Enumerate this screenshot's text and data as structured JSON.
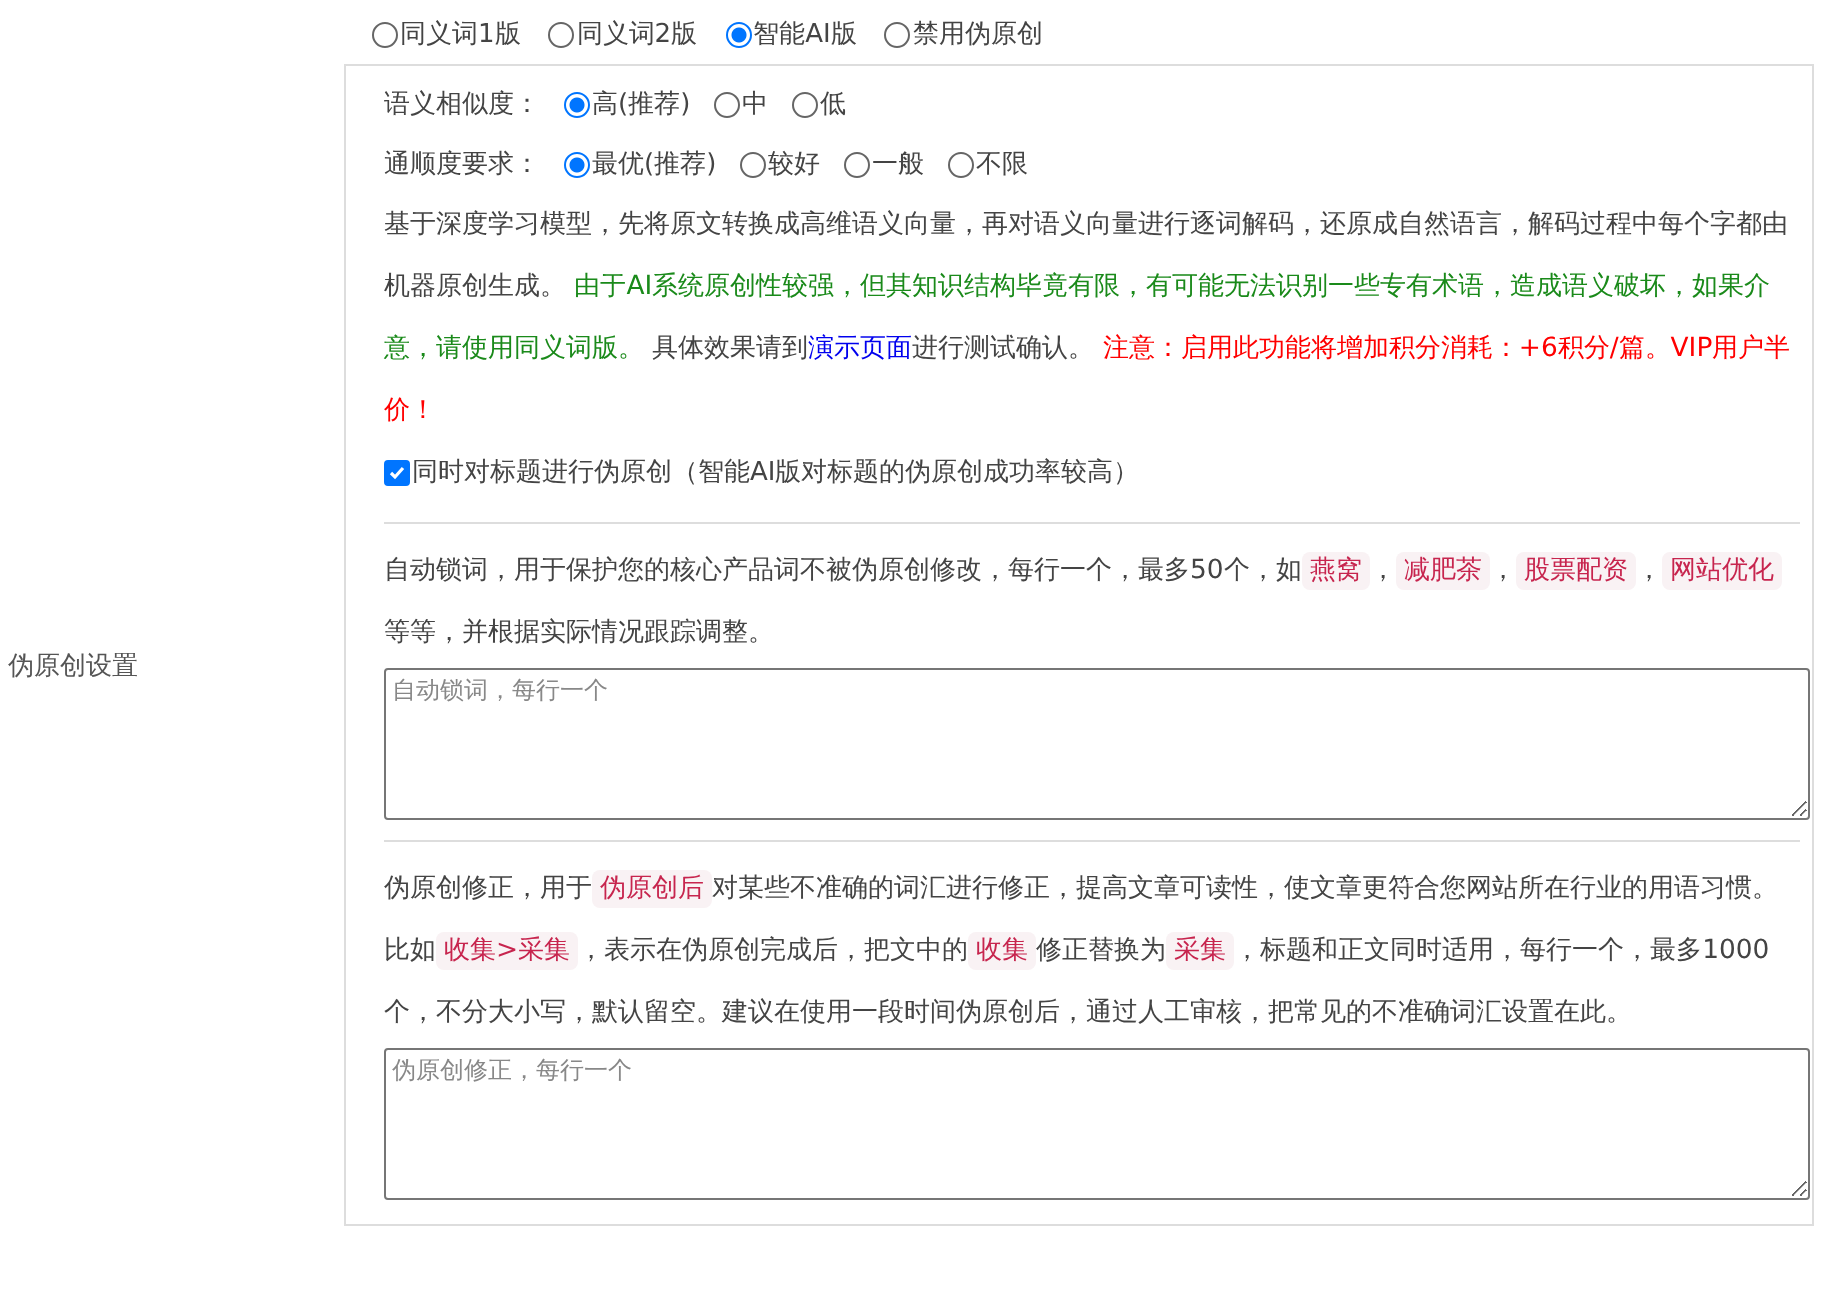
{
  "setting_label": "伪原创设置",
  "modes": [
    {
      "label": "同义词1版",
      "selected": false
    },
    {
      "label": "同义词2版",
      "selected": false
    },
    {
      "label": "智能AI版",
      "selected": true
    },
    {
      "label": "禁用伪原创",
      "selected": false
    }
  ],
  "similarity": {
    "label": "语义相似度：",
    "options": [
      {
        "label": "高(推荐)",
        "selected": true
      },
      {
        "label": "中",
        "selected": false
      },
      {
        "label": "低",
        "selected": false
      }
    ]
  },
  "fluency": {
    "label": "通顺度要求：",
    "options": [
      {
        "label": "最优(推荐)",
        "selected": true
      },
      {
        "label": "较好",
        "selected": false
      },
      {
        "label": "一般",
        "selected": false
      },
      {
        "label": "不限",
        "selected": false
      }
    ]
  },
  "description": [
    {
      "kind": "text",
      "text": "基于深度学习模型，先将原文转换成高维语义向量，再对语义向量进行逐词解码，还原成自然语言，解码过程中每个字都由机器原创生成。 "
    },
    {
      "kind": "success",
      "text": "由于AI系统原创性较强，但其知识结构毕竟有限，有可能无法识别一些专有术语，造成语义破坏，如果介意，请使用同义词版。"
    },
    {
      "kind": "text",
      "text": " 具体效果请到"
    },
    {
      "kind": "link",
      "text": "演示页面"
    },
    {
      "kind": "text",
      "text": "进行测试确认。 "
    },
    {
      "kind": "warning",
      "text": "注意：启用此功能将增加积分消耗：+6积分/篇。VIP用户半价！"
    }
  ],
  "title_option": {
    "label": "同时对标题进行伪原创（智能AI版对标题的伪原创成功率较高）",
    "checked": true
  },
  "lock_words": {
    "description": [
      {
        "kind": "text",
        "text": "自动锁词，用于保护您的核心产品词不被伪原创修改，每行一个，最多50个，如"
      },
      {
        "kind": "tag",
        "text": "燕窝"
      },
      {
        "kind": "text",
        "text": "，"
      },
      {
        "kind": "tag",
        "text": "减肥茶"
      },
      {
        "kind": "text",
        "text": "，"
      },
      {
        "kind": "tag",
        "text": "股票配资"
      },
      {
        "kind": "text",
        "text": "，"
      },
      {
        "kind": "tag",
        "text": "网站优化"
      },
      {
        "kind": "text",
        "text": " 等等，并根据实际情况跟踪调整。"
      }
    ],
    "placeholder": "自动锁词，每行一个"
  },
  "corrections": {
    "description": [
      {
        "kind": "text",
        "text": "伪原创修正，用于"
      },
      {
        "kind": "tag",
        "text": "伪原创后"
      },
      {
        "kind": "text",
        "text": "对某些不准确的词汇进行修正，提高文章可读性，使文章更符合您网站所在行业的用语习惯。比如"
      },
      {
        "kind": "tag",
        "text": "收集>采集"
      },
      {
        "kind": "text",
        "text": "，表示在伪原创完成后，把文中的"
      },
      {
        "kind": "tag",
        "text": "收集"
      },
      {
        "kind": "text",
        "text": "修正替换为"
      },
      {
        "kind": "tag",
        "text": "采集"
      },
      {
        "kind": "text",
        "text": "，标题和正文同时适用，每行一个，最多1000个，不分大小写，默认留空。建议在使用一段时间伪原创后，通过人工审核，把常见的不准确词汇设置在此。"
      }
    ],
    "placeholder": "伪原创修正，每行一个"
  }
}
